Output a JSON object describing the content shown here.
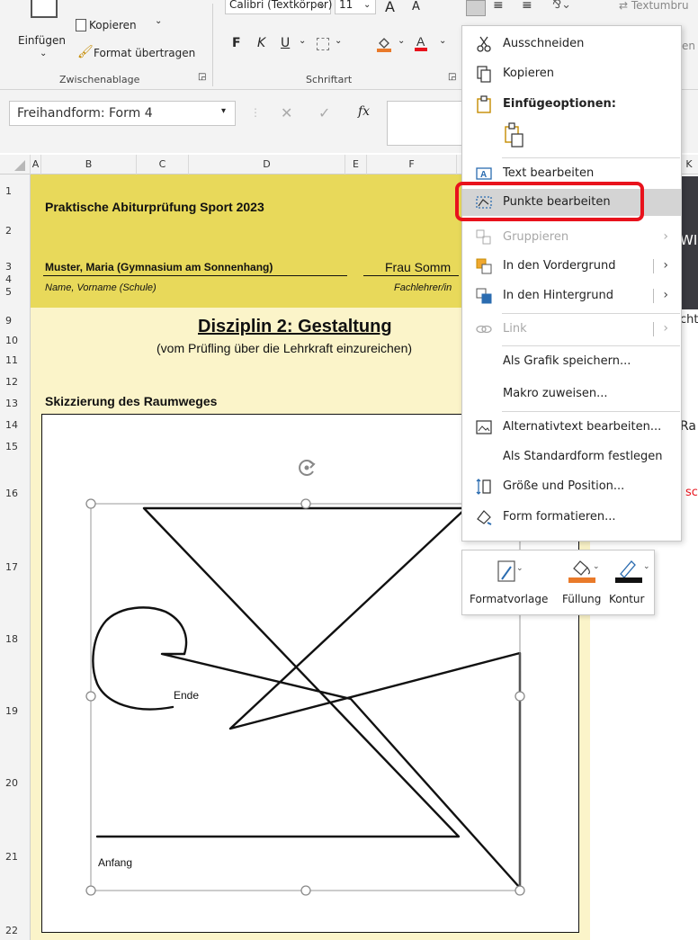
{
  "ribbon": {
    "paste_label": "Einfügen",
    "copy_label": "Kopieren",
    "format_painter_label": "Format übertragen",
    "clipboard_group": "Zwischenablage",
    "font_name": "Calibri (Textkörper)",
    "font_size": "11",
    "bold": "F",
    "italic": "K",
    "underline": "U",
    "font_group": "Schriftart",
    "wrap_text": "Textumbru",
    "partial_text": "en u"
  },
  "formula_bar": {
    "name_box": "Freihandform: Form 4",
    "fx": "fx"
  },
  "columns": [
    "A",
    "B",
    "C",
    "D",
    "E",
    "F",
    "K"
  ],
  "rows": [
    "1",
    "2",
    "3",
    "4",
    "5",
    "9",
    "10",
    "11",
    "12",
    "13",
    "14",
    "15",
    "16",
    "17",
    "18",
    "19",
    "20",
    "21",
    "22"
  ],
  "sheet": {
    "title": "Praktische Abiturprüfung Sport 2023",
    "student": "Muster, Maria (Gymnasium am Sonnenhang)",
    "teacher": "Frau Somm",
    "name_hint": "Name, Vorname (Schule)",
    "teacher_hint": "Fachlehrer/in",
    "discipline": "Disziplin 2: Gestaltung",
    "submit_note": "(vom Prüfling über die Lehrkraft einzureichen)",
    "sketch_heading": "Skizzierung des Raumweges",
    "end_label": "Ende",
    "start_label": "Anfang",
    "right_wr": "WI",
    "right_cht": "cht",
    "right_ra": "Ra",
    "right_sc": "sc"
  },
  "context_menu": {
    "items": [
      {
        "label": "Ausschneiden",
        "icon": "scissors-icon",
        "enabled": true
      },
      {
        "label": "Kopieren",
        "icon": "copy-icon",
        "enabled": true
      },
      {
        "label": "Einfügeoptionen:",
        "icon": "paste-icon",
        "enabled": true
      },
      {
        "label": "Text bearbeiten",
        "icon": "edit-text-icon",
        "enabled": true
      },
      {
        "label": "Punkte bearbeiten",
        "icon": "edit-points-icon",
        "enabled": true,
        "highlighted": true
      },
      {
        "label": "Gruppieren",
        "icon": "group-icon",
        "enabled": false
      },
      {
        "label": "In den Vordergrund",
        "icon": "bring-forward-icon",
        "enabled": true
      },
      {
        "label": "In den Hintergrund",
        "icon": "send-backward-icon",
        "enabled": true
      },
      {
        "label": "Link",
        "icon": "link-icon",
        "enabled": false
      },
      {
        "label": "Als Grafik speichern...",
        "icon": "",
        "enabled": true
      },
      {
        "label": "Makro zuweisen...",
        "icon": "",
        "enabled": true
      },
      {
        "label": "Alternativtext bearbeiten...",
        "icon": "alt-text-icon",
        "enabled": true
      },
      {
        "label": "Als Standardform festlegen",
        "icon": "",
        "enabled": true
      },
      {
        "label": "Größe und Position...",
        "icon": "size-position-icon",
        "enabled": true
      },
      {
        "label": "Form formatieren...",
        "icon": "format-shape-icon",
        "enabled": true
      }
    ]
  },
  "mini_toolbar": {
    "style_label": "Formatvorlage",
    "fill_label": "Füllung",
    "outline_label": "Kontur"
  },
  "colors": {
    "highlight_ring": "#e8121c",
    "header_yellow": "#e8d95a",
    "cream": "#fbf4c9",
    "fill_orange": "#e97a2a"
  }
}
